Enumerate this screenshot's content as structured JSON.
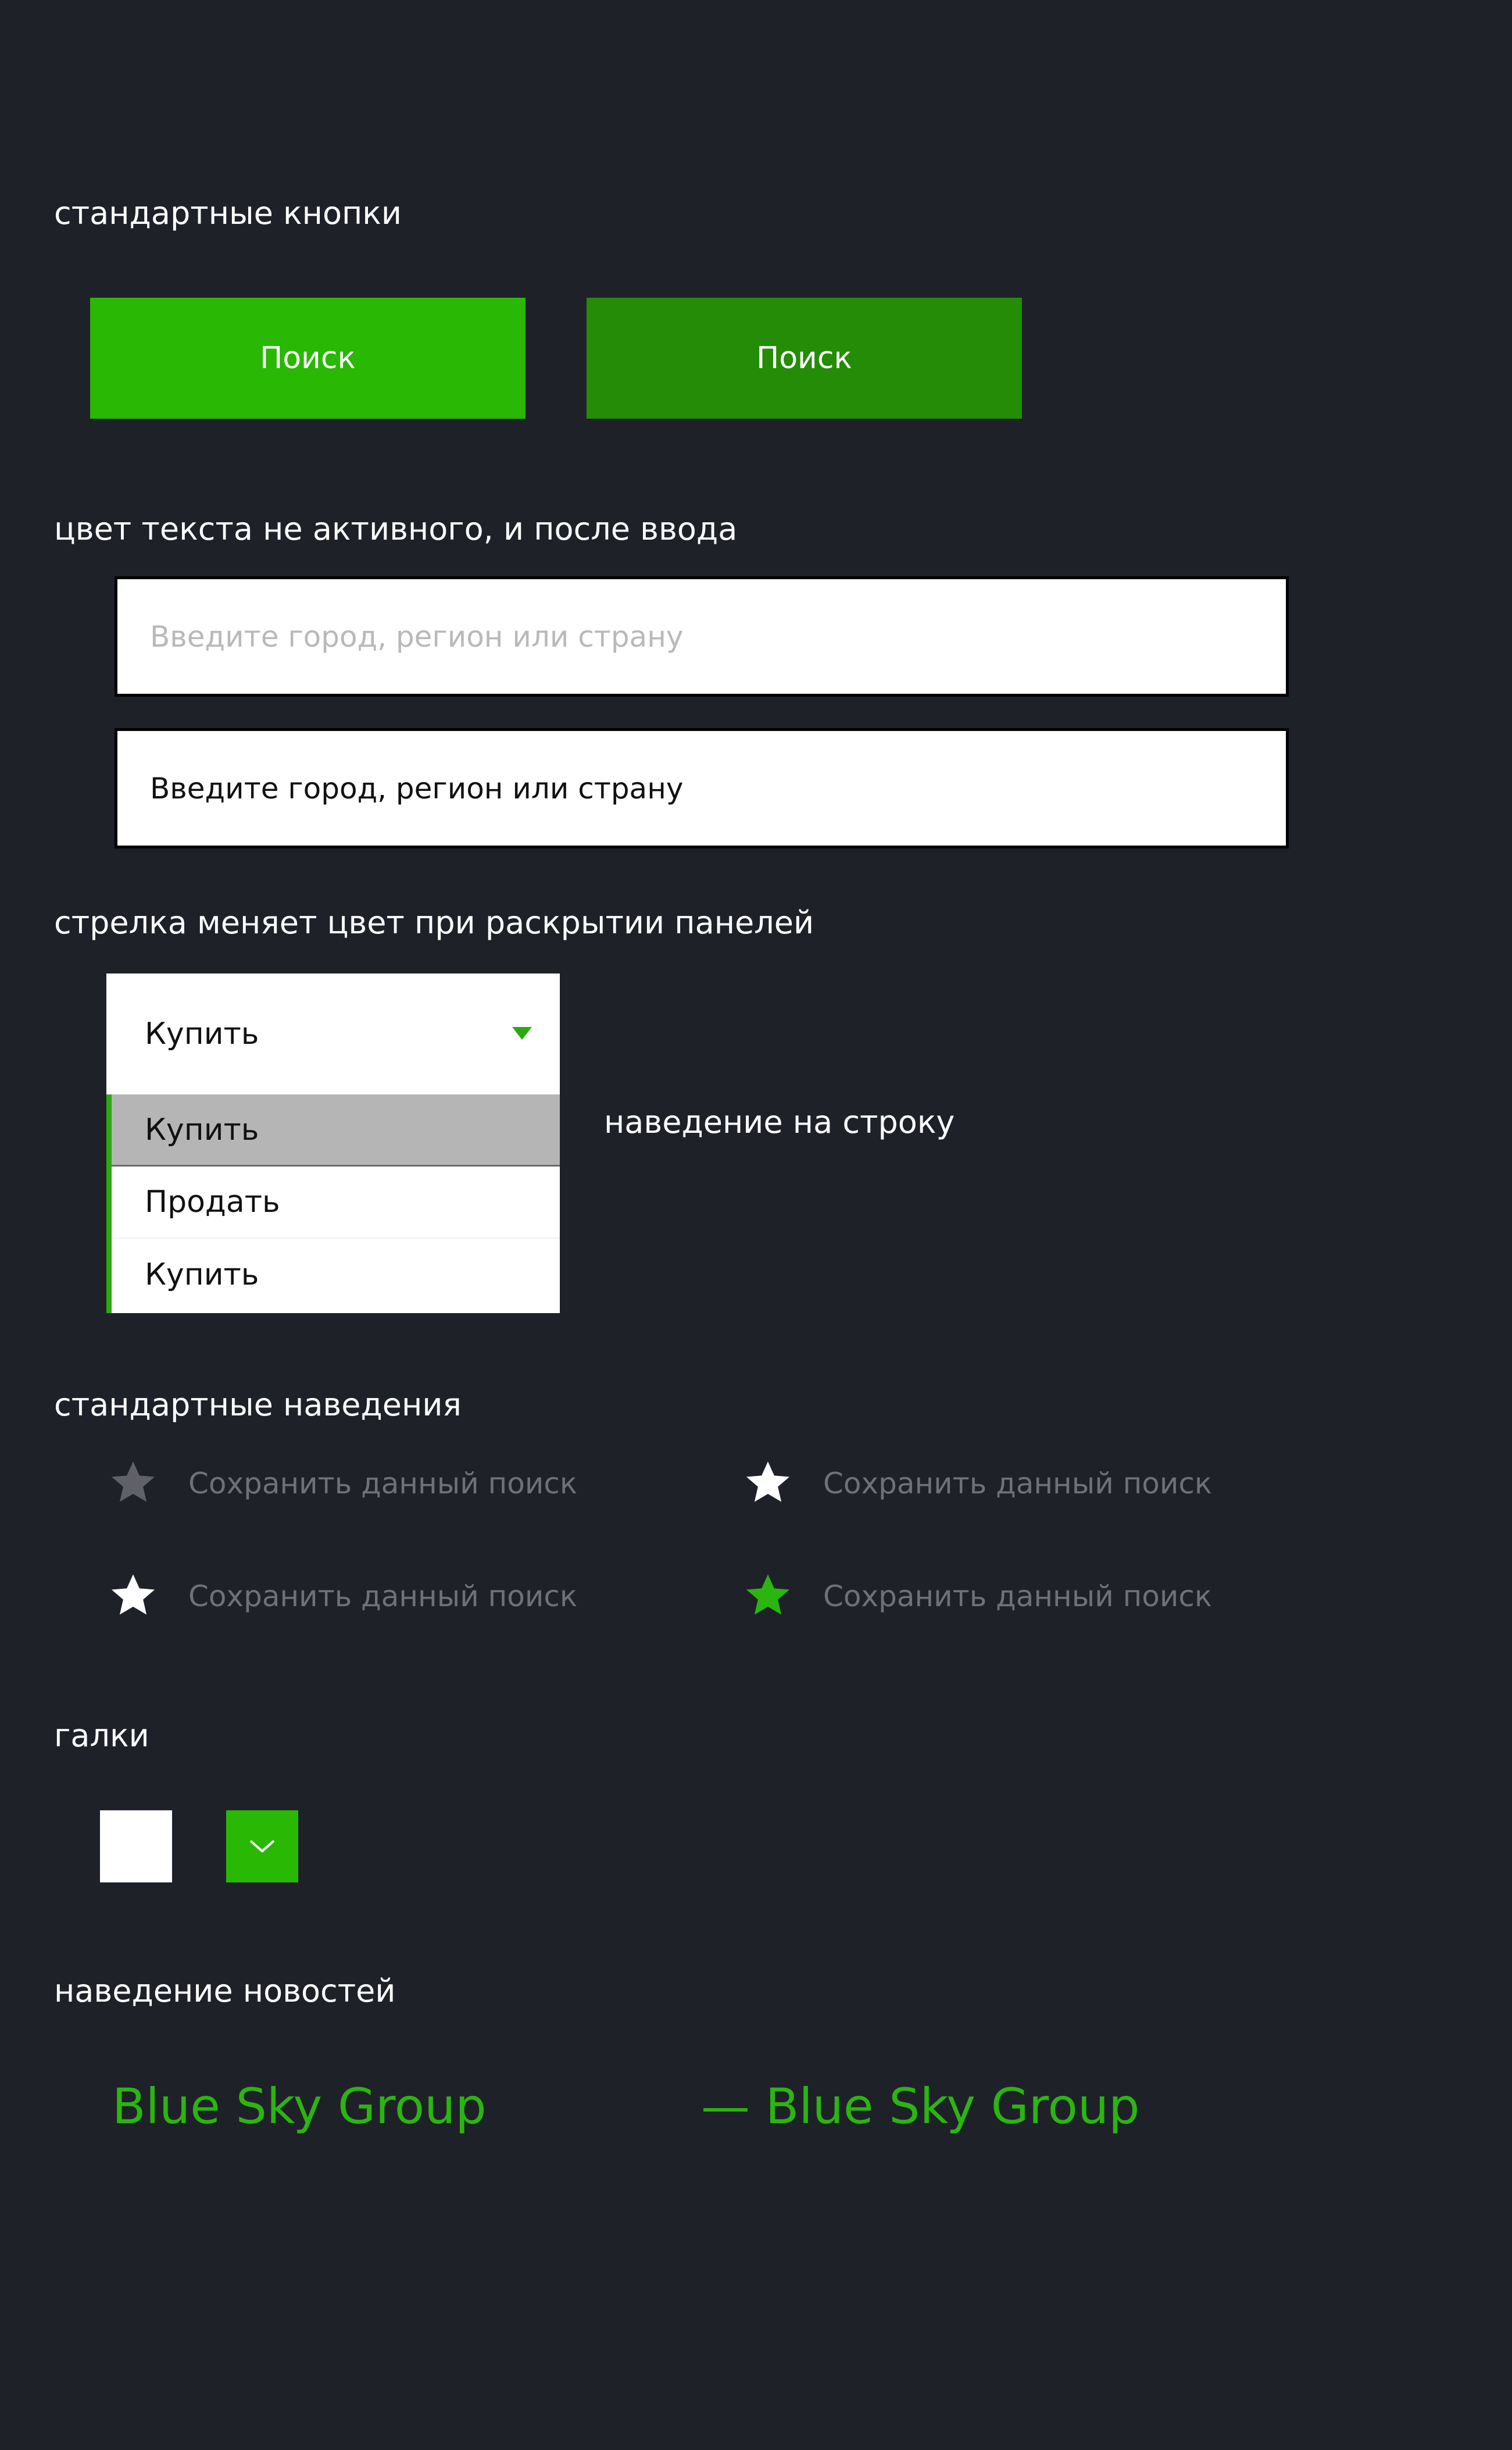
{
  "sections": {
    "buttons": "стандартные кнопки",
    "inputs": "цвет текста не активного, и после ввода",
    "dropdown": "стрелка меняет цвет при раскрытии панелей",
    "hovers": "стандартные наведения",
    "checks": "галки",
    "news": "наведение новостей"
  },
  "buttons": {
    "normal": "Поиск",
    "hover": "Поиск"
  },
  "inputs": {
    "inactive_placeholder": "Введите город, регион или страну",
    "filled_value": "Введите город, регион или страну"
  },
  "dropdown": {
    "selected": "Купить",
    "options": [
      "Купить",
      "Продать",
      "Купить"
    ],
    "hover_note": "наведение на строку"
  },
  "save_items": [
    {
      "label": "Сохранить данный поиск",
      "icon": "star-icon",
      "color": "#5f6166"
    },
    {
      "label": "Сохранить данный поиск",
      "icon": "star-icon",
      "color": "#ffffff"
    },
    {
      "label": "Сохранить данный поиск",
      "icon": "star-icon",
      "color": "#ffffff"
    },
    {
      "label": "Сохранить данный поиск",
      "icon": "star-icon",
      "color": "#2bb510"
    }
  ],
  "news": {
    "normal": "Blue Sky Group",
    "hover": "— Blue Sky Group"
  },
  "colors": {
    "background": "#1f2129",
    "accent": "#29b804",
    "accent_dark": "#248c07",
    "link": "#2bb510"
  }
}
